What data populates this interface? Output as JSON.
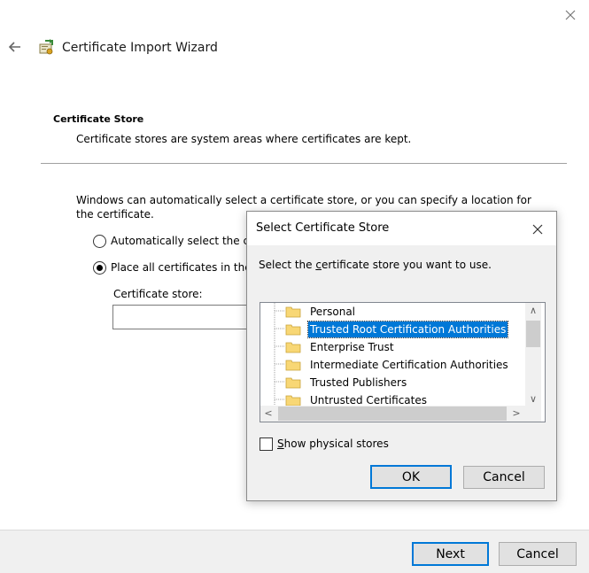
{
  "wizard": {
    "title": "Certificate Import Wizard",
    "section_title": "Certificate Store",
    "section_desc": "Certificate stores are system areas where certificates are kept.",
    "info_text": "Windows can automatically select a certificate store, or you can specify a location for the certificate.",
    "radio_auto_label": "Automatically select the c",
    "radio_place_label": "Place all certificates in the",
    "radio_selected": "place",
    "store_label": "Certificate store:",
    "store_value": "",
    "next_label": "Next",
    "cancel_label": "Cancel"
  },
  "dialog": {
    "title": "Select Certificate Store",
    "prompt_pre": "Select the ",
    "prompt_ul": "c",
    "prompt_post": "ertificate store you want to use.",
    "stores": [
      "Personal",
      "Trusted Root Certification Authorities",
      "Enterprise Trust",
      "Intermediate Certification Authorities",
      "Trusted Publishers",
      "Untrusted Certificates"
    ],
    "selected_store": "Trusted Root Certification Authorities",
    "show_physical_ul": "S",
    "show_physical_rest": "how physical stores",
    "show_physical_checked": false,
    "ok_label": "OK",
    "cancel_label": "Cancel"
  },
  "icons": {
    "close": "close-icon",
    "back": "back-arrow-icon",
    "wizard": "certificate-icon",
    "folder": "folder-icon"
  },
  "colors": {
    "accent": "#0078d7",
    "selection": "#0078d7",
    "footer": "#f0f0f0"
  }
}
